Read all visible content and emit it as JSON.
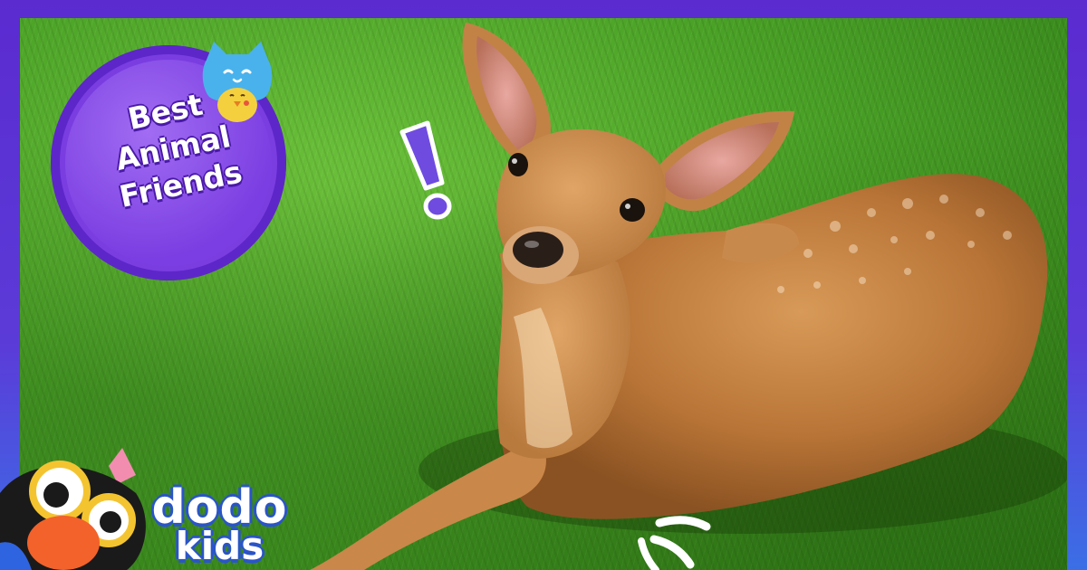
{
  "badge": {
    "line1": "Best",
    "line2": "Animal",
    "line3": "Friends"
  },
  "logo": {
    "word1": "dodo",
    "word2": "kids"
  },
  "icons": {
    "badge_mascot": "cat-and-chick-icon",
    "exclamation": "exclamation-icon",
    "logo_bird": "dodo-bird-icon",
    "sparkle": "sparkle-lines-icon"
  },
  "colors": {
    "frame_purple": "#5b2bd0",
    "badge_purple": "#7b3ee2",
    "grass_green": "#4aa226",
    "deer_fur": "#c98a48",
    "logo_blue": "#2a55c8"
  },
  "photo_subject": "fawn-lying-on-grass"
}
